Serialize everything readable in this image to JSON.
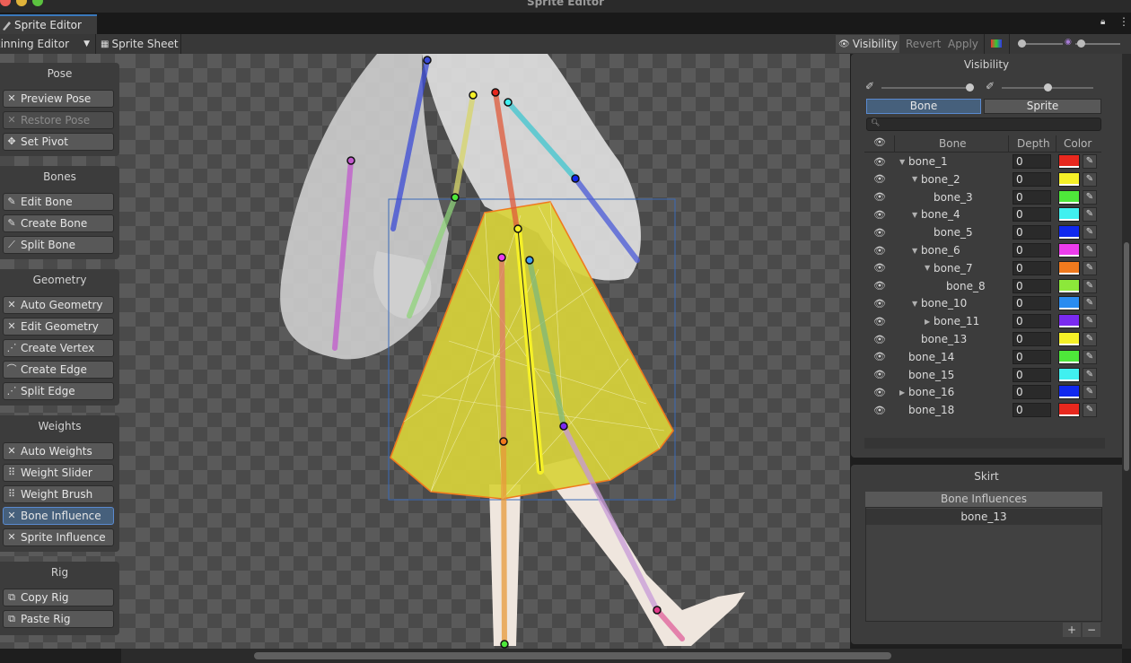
{
  "window": {
    "title": "Sprite Editor",
    "tab_label": "Sprite Editor"
  },
  "toolbar": {
    "mode_dropdown": "Skinning Editor",
    "sprite_sheet": "Sprite Sheet",
    "visibility": "Visibility",
    "revert": "Revert",
    "apply": "Apply"
  },
  "tool_groups": {
    "pose": {
      "title": "Pose",
      "tools": [
        "Preview Pose",
        "Restore Pose",
        "Set Pivot"
      ]
    },
    "bones": {
      "title": "Bones",
      "tools": [
        "Edit Bone",
        "Create Bone",
        "Split Bone"
      ]
    },
    "geometry": {
      "title": "Geometry",
      "tools": [
        "Auto Geometry",
        "Edit Geometry",
        "Create Vertex",
        "Create Edge",
        "Split Edge"
      ]
    },
    "weights": {
      "title": "Weights",
      "tools": [
        "Auto Weights",
        "Weight Slider",
        "Weight Brush",
        "Bone Influence",
        "Sprite Influence"
      ],
      "active": "Bone Influence"
    },
    "rig": {
      "title": "Rig",
      "tools": [
        "Copy Rig",
        "Paste Rig"
      ]
    }
  },
  "visibility_panel": {
    "title": "Visibility",
    "tabs": [
      "Bone",
      "Sprite"
    ],
    "active_tab": "Bone",
    "search_placeholder": "",
    "columns": [
      "Bone",
      "Depth",
      "Color"
    ],
    "bones": [
      {
        "name": "bone_1",
        "depth": "0",
        "color": "#e8281e",
        "indent": 0,
        "expander": "open"
      },
      {
        "name": "bone_2",
        "depth": "0",
        "color": "#f5f028",
        "indent": 1,
        "expander": "open"
      },
      {
        "name": "bone_3",
        "depth": "0",
        "color": "#4ee83a",
        "indent": 2,
        "expander": ""
      },
      {
        "name": "bone_4",
        "depth": "0",
        "color": "#40f0f0",
        "indent": 1,
        "expander": "open"
      },
      {
        "name": "bone_5",
        "depth": "0",
        "color": "#1028ee",
        "indent": 2,
        "expander": ""
      },
      {
        "name": "bone_6",
        "depth": "0",
        "color": "#ec3cec",
        "indent": 1,
        "expander": "open"
      },
      {
        "name": "bone_7",
        "depth": "0",
        "color": "#f07a1e",
        "indent": 2,
        "expander": "open"
      },
      {
        "name": "bone_8",
        "depth": "0",
        "color": "#8ce83a",
        "indent": 3,
        "expander": ""
      },
      {
        "name": "bone_10",
        "depth": "0",
        "color": "#2a8cf0",
        "indent": 1,
        "expander": "open"
      },
      {
        "name": "bone_11",
        "depth": "0",
        "color": "#7a2af0",
        "indent": 2,
        "expander": "closed"
      },
      {
        "name": "bone_13",
        "depth": "0",
        "color": "#f5f028",
        "indent": 1,
        "expander": ""
      },
      {
        "name": "bone_14",
        "depth": "0",
        "color": "#4ee83a",
        "indent": 0,
        "expander": ""
      },
      {
        "name": "bone_15",
        "depth": "0",
        "color": "#40f0f0",
        "indent": 0,
        "expander": ""
      },
      {
        "name": "bone_16",
        "depth": "0",
        "color": "#1028ee",
        "indent": 0,
        "expander": "closed"
      },
      {
        "name": "bone_18",
        "depth": "0",
        "color": "#e8281e",
        "indent": 0,
        "expander": ""
      }
    ]
  },
  "influence_panel": {
    "title": "Skirt",
    "header": "Bone Influences",
    "items": [
      "bone_13"
    ],
    "add_label": "+",
    "remove_label": "−"
  }
}
